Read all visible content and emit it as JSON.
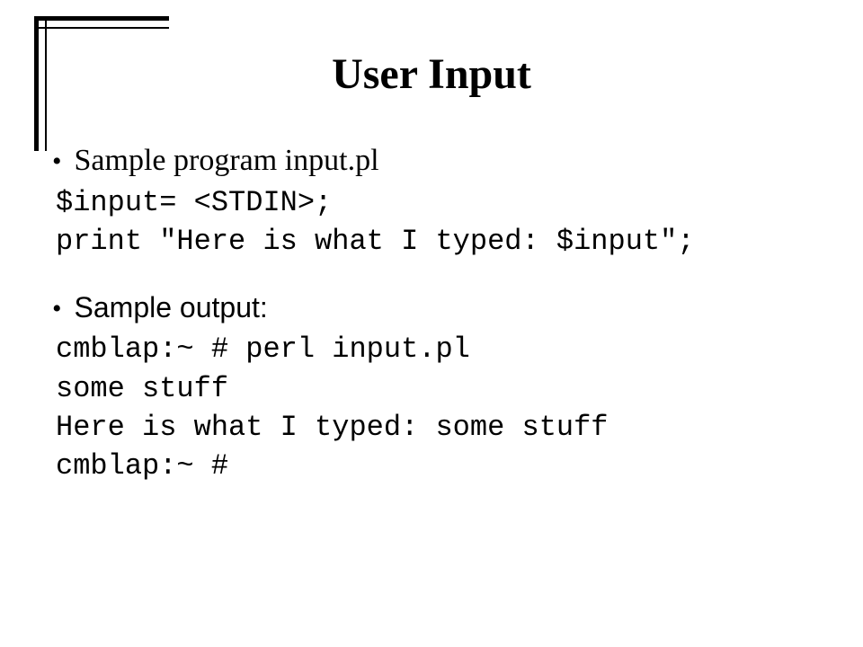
{
  "title": "User Input",
  "bullets": {
    "first": "Sample program input.pl",
    "second": "Sample output:"
  },
  "code_block_1": {
    "line1": "$input= <STDIN>;",
    "line2": "print \"Here is what I typed: $input\";"
  },
  "code_block_2": {
    "line1": "cmblap:~ # perl input.pl",
    "line2": "some stuff",
    "line3": "Here is what I typed: some stuff",
    "line4": "cmblap:~ #"
  }
}
